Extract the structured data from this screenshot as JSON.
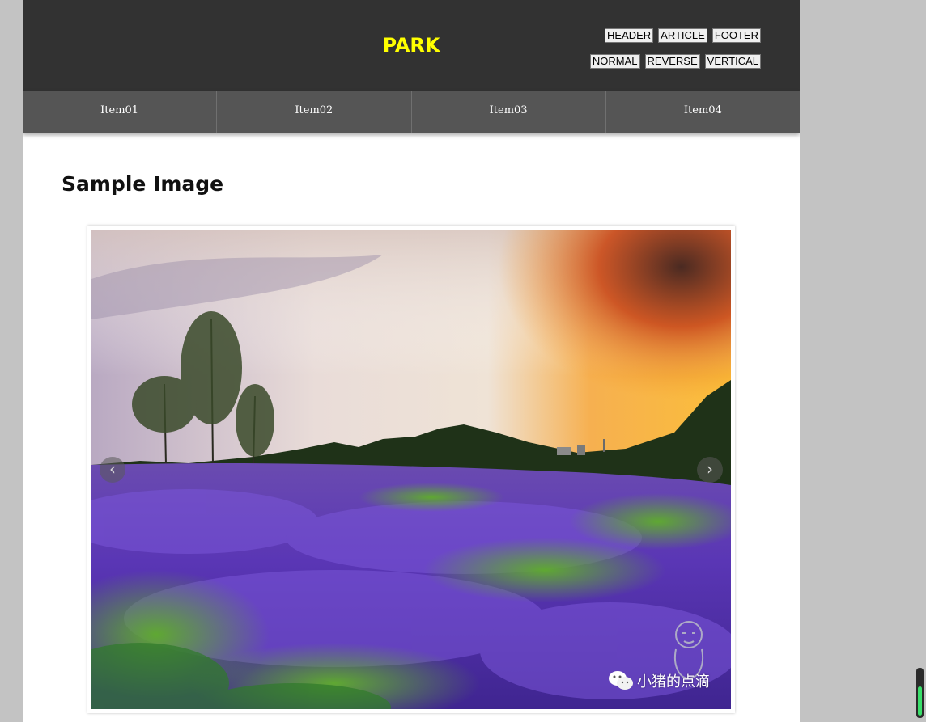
{
  "header": {
    "title": "PARK",
    "title_color": "#ffff00",
    "buttons_row1": [
      "HEADER",
      "ARTICLE",
      "FOOTER"
    ],
    "buttons_row2": [
      "NORMAL",
      "REVERSE",
      "VERTICAL"
    ]
  },
  "nav": {
    "items": [
      "Item01",
      "Item02",
      "Item03",
      "Item04"
    ]
  },
  "main": {
    "heading": "Sample Image",
    "carousel": {
      "prev_icon": "chevron-left-icon",
      "next_icon": "chevron-right-icon",
      "watermark_text": "小猪的点滴",
      "watermark_icon": "wechat-icon"
    }
  },
  "colors": {
    "header_bg": "#323232",
    "nav_bg": "#555555",
    "page_bg": "#c3c3c3",
    "scroll_fill": "#3adf6b"
  }
}
